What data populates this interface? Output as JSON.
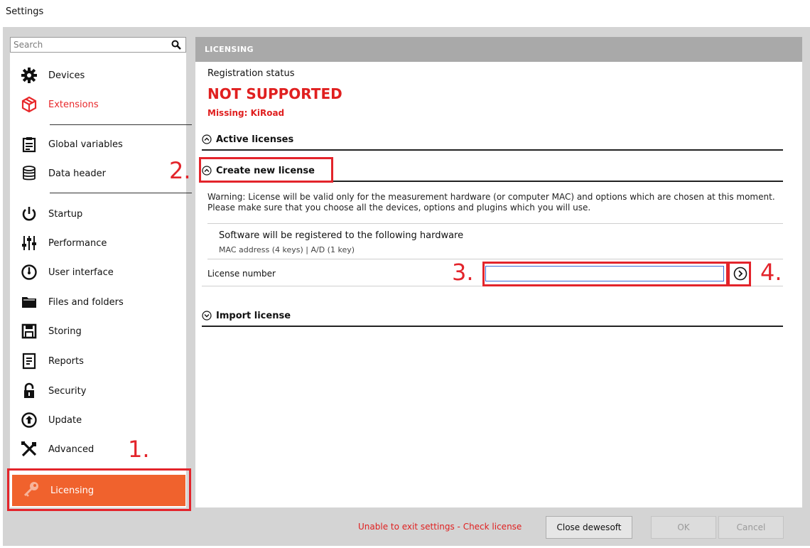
{
  "window": {
    "title": "Settings"
  },
  "search": {
    "placeholder": "Search"
  },
  "sidebar": {
    "items": [
      {
        "label": "Devices",
        "icon": "gear-icon"
      },
      {
        "label": "Extensions",
        "icon": "package-icon",
        "color": "#e8282b"
      },
      {
        "label": "Global variables",
        "icon": "clipboard-icon"
      },
      {
        "label": "Data header",
        "icon": "database-icon"
      },
      {
        "label": "Startup",
        "icon": "power-icon"
      },
      {
        "label": "Performance",
        "icon": "sliders-icon"
      },
      {
        "label": "User interface",
        "icon": "gauge-icon"
      },
      {
        "label": "Files and folders",
        "icon": "folder-icon"
      },
      {
        "label": "Storing",
        "icon": "save-icon"
      },
      {
        "label": "Reports",
        "icon": "report-icon"
      },
      {
        "label": "Security",
        "icon": "lock-icon"
      },
      {
        "label": "Update",
        "icon": "upload-icon"
      },
      {
        "label": "Advanced",
        "icon": "tools-icon"
      }
    ],
    "selected": {
      "label": "Licensing",
      "icon": "key-icon",
      "color": "#f0622d"
    }
  },
  "panel": {
    "header": "LICENSING",
    "registration_label": "Registration status",
    "status": "NOT SUPPORTED",
    "missing": "Missing: KiRoad",
    "sections": {
      "active": "Active licenses",
      "create": "Create new license",
      "import": "Import license"
    },
    "warning": "Warning: License will be valid only for the measurement hardware (or computer MAC) and options which are chosen at this moment. Please make sure that you choose all the devices, options and plugins which you will use.",
    "hardware_title": "Software will be registered to the following hardware",
    "hardware_detail": "MAC address (4 keys) | A/D (1 key)",
    "license_label": "License number",
    "license_value": ""
  },
  "annotations": {
    "step1": "1.",
    "step2": "2.",
    "step3": "3.",
    "step4": "4."
  },
  "footer": {
    "message": "Unable to exit settings - Check license",
    "close_label": "Close dewesoft",
    "ok_label": "OK",
    "cancel_label": "Cancel"
  },
  "colors": {
    "accent": "#f0622d",
    "error": "#e01f1f",
    "annotation": "#e3242b"
  }
}
